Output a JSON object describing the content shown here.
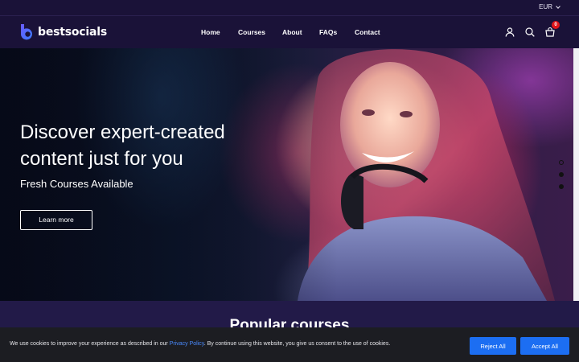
{
  "topbar": {
    "currency": "EUR"
  },
  "header": {
    "brand": "bestsocials",
    "nav": [
      {
        "label": "Home"
      },
      {
        "label": "Courses"
      },
      {
        "label": "About"
      },
      {
        "label": "FAQs"
      },
      {
        "label": "Contact"
      }
    ],
    "cart_count": "0",
    "icons": [
      "user-icon",
      "search-icon",
      "cart-icon"
    ]
  },
  "hero": {
    "title": "Discover expert-created content just for you",
    "subtitle": "Fresh Courses Available",
    "cta_label": "Learn more",
    "slides": 3,
    "active_slide": 1
  },
  "section": {
    "title": "Popular courses"
  },
  "cookie": {
    "text_before": "We use cookies to improve your experience as described in our ",
    "link": "Privacy Policy",
    "text_after": ". By continue using this website, you give us consent to the use of cookies.",
    "reject_label": "Reject All",
    "accept_label": "Accept All"
  },
  "colors": {
    "background": "#1a1238",
    "section": "#221a48",
    "button_blue": "#1c6ef2",
    "badge_red": "#e0161b",
    "cookie_bg": "#1c1d22"
  }
}
